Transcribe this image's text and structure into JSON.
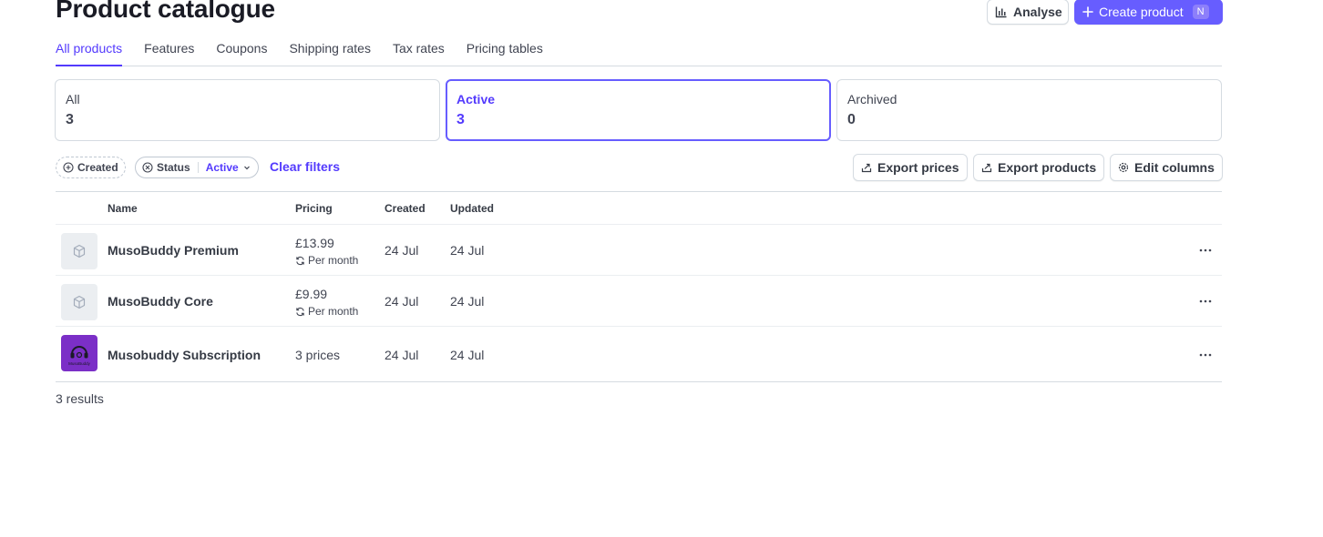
{
  "page": {
    "title": "Product catalogue"
  },
  "header": {
    "analyse_label": "Analyse",
    "create_label": "Create product",
    "create_shortcut": "N"
  },
  "tabs": [
    {
      "label": "All products",
      "active": true
    },
    {
      "label": "Features"
    },
    {
      "label": "Coupons"
    },
    {
      "label": "Shipping rates"
    },
    {
      "label": "Tax rates"
    },
    {
      "label": "Pricing tables"
    }
  ],
  "stats": [
    {
      "label": "All",
      "count": "3"
    },
    {
      "label": "Active",
      "count": "3",
      "selected": true
    },
    {
      "label": "Archived",
      "count": "0"
    }
  ],
  "filters": {
    "created_label": "Created",
    "status_label": "Status",
    "status_value": "Active",
    "clear_label": "Clear filters"
  },
  "actions": {
    "export_prices": "Export prices",
    "export_products": "Export products",
    "edit_columns": "Edit columns"
  },
  "table": {
    "columns": [
      "Name",
      "Pricing",
      "Created",
      "Updated"
    ],
    "rows": [
      {
        "name": "MusoBuddy Premium",
        "price": "£13.99",
        "interval": "Per month",
        "created": "24 Jul",
        "updated": "24 Jul",
        "thumb": "box-icon"
      },
      {
        "name": "MusoBuddy Core",
        "price": "£9.99",
        "interval": "Per month",
        "created": "24 Jul",
        "updated": "24 Jul",
        "thumb": "box-icon"
      },
      {
        "name": "Musobuddy Subscription",
        "price": "3 prices",
        "interval": "",
        "created": "24 Jul",
        "updated": "24 Jul",
        "thumb": "musobuddy-logo",
        "logo_text": "MusoBuddy"
      }
    ]
  },
  "footer": {
    "results": "3 results"
  },
  "colors": {
    "accent": "#533afd",
    "primary_button": "#675dff",
    "border": "#d5dbe1",
    "logo_bg": "#7b2fc7"
  }
}
